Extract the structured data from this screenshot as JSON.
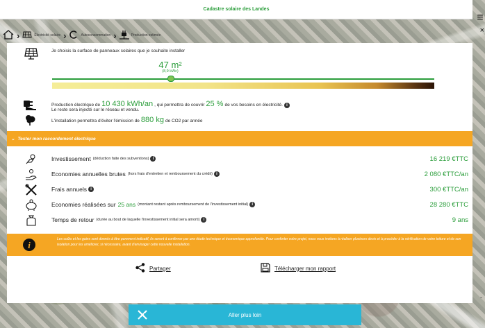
{
  "app": {
    "title": "Cadastre solaire des Landes"
  },
  "breadcrumb": {
    "items": [
      {
        "label": "",
        "icon": "home-icon"
      },
      {
        "label": "Électricité solaire",
        "icon": "solar-panel-icon"
      },
      {
        "label": "Autoconsommation",
        "icon": "cycle-icon"
      },
      {
        "label": "Production estimée",
        "icon": "plug-icon"
      }
    ]
  },
  "surface": {
    "label": "Je choisis la surface de panneaux solaires que je souhaite installer",
    "value": "47 m²",
    "kwc": "(8,9 kWc)",
    "slider_fraction": 0.31
  },
  "production": {
    "prefix": "Production électrique de",
    "value": "10 430 kWh/an",
    "middle": ", qui permettra de couvrir",
    "percent": "25 %",
    "suffix": "de vos besoins en électricité.",
    "sub": "Le reste sera injecté sur le réseau et vendu."
  },
  "co2": {
    "prefix": "L'installation permettra d'éviter l'émission de",
    "value": "880 kg",
    "suffix": "de CO2 par année"
  },
  "connection": {
    "label": "Tester mon raccordement électrique"
  },
  "finance": {
    "rows": [
      {
        "label": "Investissement",
        "note": "(déduction faite des subventions)",
        "value": "16 219 €TTC",
        "icon": "hand-coin-icon"
      },
      {
        "label": "Economies annuelles brutes",
        "note": "(hors frais d'entretien et remboursement du crédit)",
        "value": "2 080 €TTC/an",
        "icon": "hand-savings-icon"
      },
      {
        "label": "Frais annuels",
        "note": "",
        "value": "300 €TTC/an",
        "icon": "tools-icon"
      },
      {
        "label": "Economies réalisées sur",
        "highlight": "25 ans",
        "note": "(montant restant après remboursement de l'investissement initial)",
        "value": "28 280 €TTC",
        "icon": "piggy-bank-icon"
      },
      {
        "label": "Temps de retour",
        "note": "(durée au bout de laquelle l'investissement initial sera amorti)",
        "value": "9 ans",
        "icon": "money-bag-icon"
      }
    ]
  },
  "disclaimer": {
    "text": "Les coûts et les gains sont donnés à titre purement indicatif, ils seront à confirmer par une étude technique et économique approfondie. Pour conforter votre projet, nous vous invitons à réaliser plusieurs devis et à procéder à la vérification de votre toiture et de son isolation pour les améliorer, si nécessaire, avant d'envisager cette nouvelle installation."
  },
  "actions": {
    "share": "Partager",
    "download": "Télécharger mon rapport"
  },
  "cta": {
    "label": "Aller plus loin"
  },
  "colors": {
    "green": "#2a9d3a",
    "orange": "#f5a623",
    "cta": "#29b6d6"
  }
}
